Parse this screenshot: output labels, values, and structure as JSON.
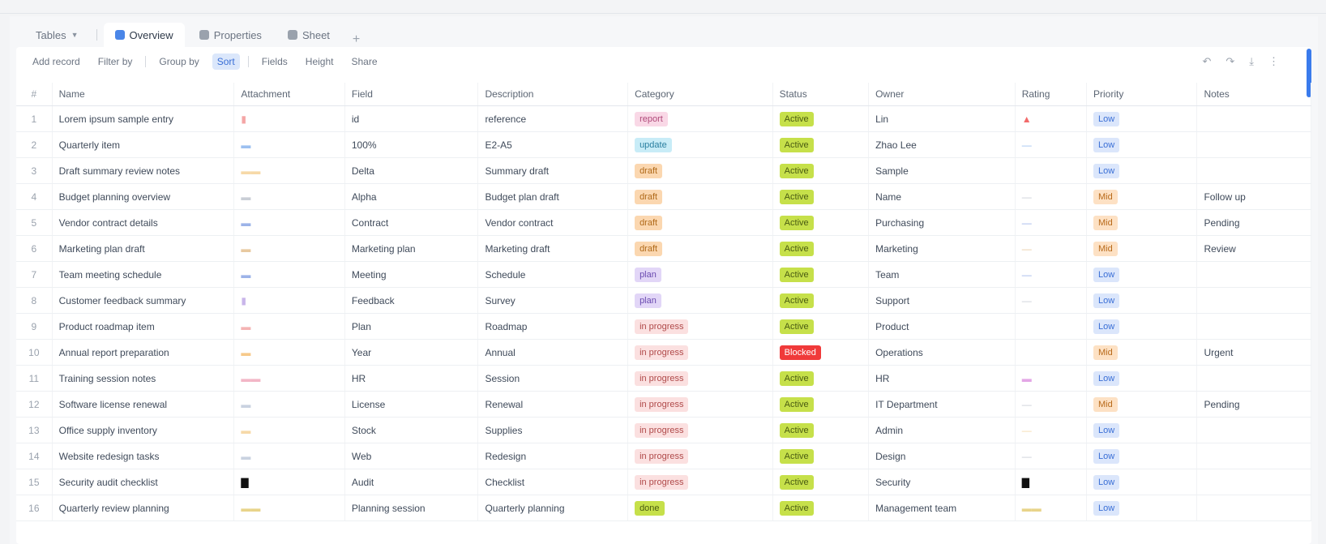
{
  "tabs": {
    "first": "Tables",
    "items": [
      {
        "label": "Overview",
        "color": "#4a86e8",
        "active": true
      },
      {
        "label": "Properties",
        "color": "#9aa2ad",
        "active": false
      },
      {
        "label": "Sheet",
        "color": "#9aa2ad",
        "active": false
      }
    ],
    "add": "+"
  },
  "toolbar": {
    "buttons": [
      {
        "label": "Add record",
        "on": false
      },
      {
        "label": "Filter by",
        "on": false
      },
      {
        "label": "Group by",
        "on": false
      },
      {
        "label": "Sort",
        "on": true
      },
      {
        "label": "Fields",
        "on": false
      },
      {
        "label": "Height",
        "on": false
      },
      {
        "label": "Share",
        "on": false
      }
    ],
    "right": [
      "↶",
      "↷",
      "⤓",
      "⋮"
    ]
  },
  "table": {
    "columns": [
      "#",
      "Name",
      "Attachment",
      "Field",
      "Description",
      "Category",
      "Status",
      "Owner",
      "Rating",
      "Priority",
      "Notes"
    ],
    "rows": [
      {
        "n": "1",
        "name": "Lorem ipsum sample entry",
        "att": "▮",
        "attColor": "#f4a6a6",
        "f1": "id",
        "desc": "reference",
        "cat": "report",
        "catBg": "#f9d8e6",
        "catFg": "#b04a7a",
        "status": "Active",
        "stBg": "#c6e04a",
        "stFg": "#4a5b12",
        "owner": "Lin",
        "rate": "▲",
        "rateColor": "#f26b6b",
        "pri": "Low",
        "priBg": "#dbe6fb",
        "priFg": "#3a6fd6",
        "notes": ""
      },
      {
        "n": "2",
        "name": "Quarterly item",
        "att": "▬",
        "attColor": "#9cc0f0",
        "f1": "100%",
        "desc": "E2-A5",
        "cat": "update",
        "catBg": "#c8ecf7",
        "catFg": "#2a7fa0",
        "status": "Active",
        "stBg": "#c6e04a",
        "stFg": "#4a5b12",
        "owner": "Zhao Lee",
        "rate": "—",
        "rateColor": "#9cc0f0",
        "pri": "Low",
        "priBg": "#dbe6fb",
        "priFg": "#3a6fd6",
        "notes": ""
      },
      {
        "n": "3",
        "name": "Draft summary review notes",
        "att": "▬▬",
        "attColor": "#f6d9a8",
        "f1": "Delta",
        "desc": "Summary draft",
        "cat": "draft",
        "catBg": "#fbd7b0",
        "catFg": "#b06a1a",
        "status": "Active",
        "stBg": "#c6e04a",
        "stFg": "#4a5b12",
        "owner": "Sample",
        "rate": "",
        "rateColor": "#f6d9a8",
        "pri": "Low",
        "priBg": "#dbe6fb",
        "priFg": "#3a6fd6",
        "notes": ""
      },
      {
        "n": "4",
        "name": "Budget planning overview",
        "att": "▬",
        "attColor": "#c9ced6",
        "f1": "Alpha",
        "desc": "Budget plan draft",
        "cat": "draft",
        "catBg": "#fbd7b0",
        "catFg": "#b06a1a",
        "status": "Active",
        "stBg": "#c6e04a",
        "stFg": "#4a5b12",
        "owner": "Name",
        "rate": "—",
        "rateColor": "#c9ced6",
        "pri": "Mid",
        "priBg": "#fde1c4",
        "priFg": "#b86a1a",
        "notes": "Follow up"
      },
      {
        "n": "5",
        "name": "Vendor contract details",
        "att": "▬",
        "attColor": "#9cb3e8",
        "f1": "Contract",
        "desc": "Vendor contract",
        "cat": "draft",
        "catBg": "#fbd7b0",
        "catFg": "#b06a1a",
        "status": "Active",
        "stBg": "#c6e04a",
        "stFg": "#4a5b12",
        "owner": "Purchasing",
        "rate": "—",
        "rateColor": "#9cb3e8",
        "pri": "Mid",
        "priBg": "#fde1c4",
        "priFg": "#b86a1a",
        "notes": "Pending"
      },
      {
        "n": "6",
        "name": "Marketing plan draft",
        "att": "▬",
        "attColor": "#e8c9a0",
        "f1": "Marketing plan",
        "desc": "Marketing draft",
        "cat": "draft",
        "catBg": "#fbd7b0",
        "catFg": "#b06a1a",
        "status": "Active",
        "stBg": "#c6e04a",
        "stFg": "#4a5b12",
        "owner": "Marketing",
        "rate": "—",
        "rateColor": "#e8c9a0",
        "pri": "Mid",
        "priBg": "#fde1c4",
        "priFg": "#b86a1a",
        "notes": "Review"
      },
      {
        "n": "7",
        "name": "Team meeting schedule",
        "att": "▬",
        "attColor": "#9cb3e8",
        "f1": "Meeting",
        "desc": "Schedule",
        "cat": "plan",
        "catBg": "#e2d6f7",
        "catFg": "#6a4ab0",
        "status": "Active",
        "stBg": "#c6e04a",
        "stFg": "#4a5b12",
        "owner": "Team",
        "rate": "—",
        "rateColor": "#9cb3e8",
        "pri": "Low",
        "priBg": "#dbe6fb",
        "priFg": "#3a6fd6",
        "notes": ""
      },
      {
        "n": "8",
        "name": "Customer feedback summary",
        "att": "▮",
        "attColor": "#c9b6ea",
        "f1": "Feedback",
        "desc": "Survey",
        "cat": "plan",
        "catBg": "#e2d6f7",
        "catFg": "#6a4ab0",
        "status": "Active",
        "stBg": "#c6e04a",
        "stFg": "#4a5b12",
        "owner": "Support",
        "rate": "—",
        "rateColor": "#c9ced6",
        "pri": "Low",
        "priBg": "#dbe6fb",
        "priFg": "#3a6fd6",
        "notes": ""
      },
      {
        "n": "9",
        "name": "Product roadmap item",
        "att": "▬",
        "attColor": "#f4b3b3",
        "f1": "Plan",
        "desc": "Roadmap",
        "cat": "in progress",
        "catBg": "#fbe0e0",
        "catFg": "#b04a4a",
        "status": "Active",
        "stBg": "#c6e04a",
        "stFg": "#4a5b12",
        "owner": "Product",
        "rate": "",
        "rateColor": "#f4b3b3",
        "pri": "Low",
        "priBg": "#dbe6fb",
        "priFg": "#3a6fd6",
        "notes": ""
      },
      {
        "n": "10",
        "name": "Annual report preparation",
        "att": "▬",
        "attColor": "#f6c98a",
        "f1": "Year",
        "desc": "Annual",
        "cat": "in progress",
        "catBg": "#fbe0e0",
        "catFg": "#b04a4a",
        "status": "Blocked",
        "stBg": "#f03a3a",
        "stFg": "#ffffff",
        "owner": "Operations",
        "rate": "",
        "rateColor": "#ffffff",
        "pri": "Mid",
        "priBg": "#fde1c4",
        "priFg": "#b86a1a",
        "notes": "Urgent"
      },
      {
        "n": "11",
        "name": "Training session notes",
        "att": "▬▬",
        "attColor": "#f2b6c6",
        "f1": "HR",
        "desc": "Session",
        "cat": "in progress",
        "catBg": "#fbe0e0",
        "catFg": "#b04a4a",
        "status": "Active",
        "stBg": "#c6e04a",
        "stFg": "#4a5b12",
        "owner": "HR",
        "rate": "▬",
        "rateColor": "#e3a6e6",
        "pri": "Low",
        "priBg": "#dbe6fb",
        "priFg": "#3a6fd6",
        "notes": ""
      },
      {
        "n": "12",
        "name": "Software license renewal",
        "att": "▬",
        "attColor": "#c9d2e0",
        "f1": "License",
        "desc": "Renewal",
        "cat": "in progress",
        "catBg": "#fbe0e0",
        "catFg": "#b04a4a",
        "status": "Active",
        "stBg": "#c6e04a",
        "stFg": "#4a5b12",
        "owner": "IT Department",
        "rate": "—",
        "rateColor": "#c9ced6",
        "pri": "Mid",
        "priBg": "#fde1c4",
        "priFg": "#b86a1a",
        "notes": "Pending"
      },
      {
        "n": "13",
        "name": "Office supply inventory",
        "att": "▬",
        "attColor": "#f6d9a8",
        "f1": "Stock",
        "desc": "Supplies",
        "cat": "in progress",
        "catBg": "#fbe0e0",
        "catFg": "#b04a4a",
        "status": "Active",
        "stBg": "#c6e04a",
        "stFg": "#4a5b12",
        "owner": "Admin",
        "rate": "—",
        "rateColor": "#f6d9a8",
        "pri": "Low",
        "priBg": "#dbe6fb",
        "priFg": "#3a6fd6",
        "notes": ""
      },
      {
        "n": "14",
        "name": "Website redesign tasks",
        "att": "▬",
        "attColor": "#c9d2e0",
        "f1": "Web",
        "desc": "Redesign",
        "cat": "in progress",
        "catBg": "#fbe0e0",
        "catFg": "#b04a4a",
        "status": "Active",
        "stBg": "#c6e04a",
        "stFg": "#4a5b12",
        "owner": "Design",
        "rate": "—",
        "rateColor": "#c9ced6",
        "pri": "Low",
        "priBg": "#dbe6fb",
        "priFg": "#3a6fd6",
        "notes": ""
      },
      {
        "n": "15",
        "name": "Security audit checklist",
        "att": "▇",
        "attColor": "#111111",
        "f1": "Audit",
        "desc": "Checklist",
        "cat": "in progress",
        "catBg": "#fbe0e0",
        "catFg": "#b04a4a",
        "status": "Active",
        "stBg": "#c6e04a",
        "stFg": "#4a5b12",
        "owner": "Security",
        "rate": "▇",
        "rateColor": "#111111",
        "pri": "Low",
        "priBg": "#dbe6fb",
        "priFg": "#3a6fd6",
        "notes": ""
      },
      {
        "n": "16",
        "name": "Quarterly review planning",
        "att": "▬▬",
        "attColor": "#e8d48a",
        "f1": "Planning session",
        "desc": "Quarterly planning",
        "cat": "done",
        "catBg": "#c6e04a",
        "catFg": "#4a5b12",
        "status": "Active",
        "stBg": "#c6e04a",
        "stFg": "#4a5b12",
        "owner": "Management team",
        "rate": "▬▬",
        "rateColor": "#e8d48a",
        "pri": "Low",
        "priBg": "#dbe6fb",
        "priFg": "#3a6fd6",
        "notes": ""
      }
    ]
  }
}
